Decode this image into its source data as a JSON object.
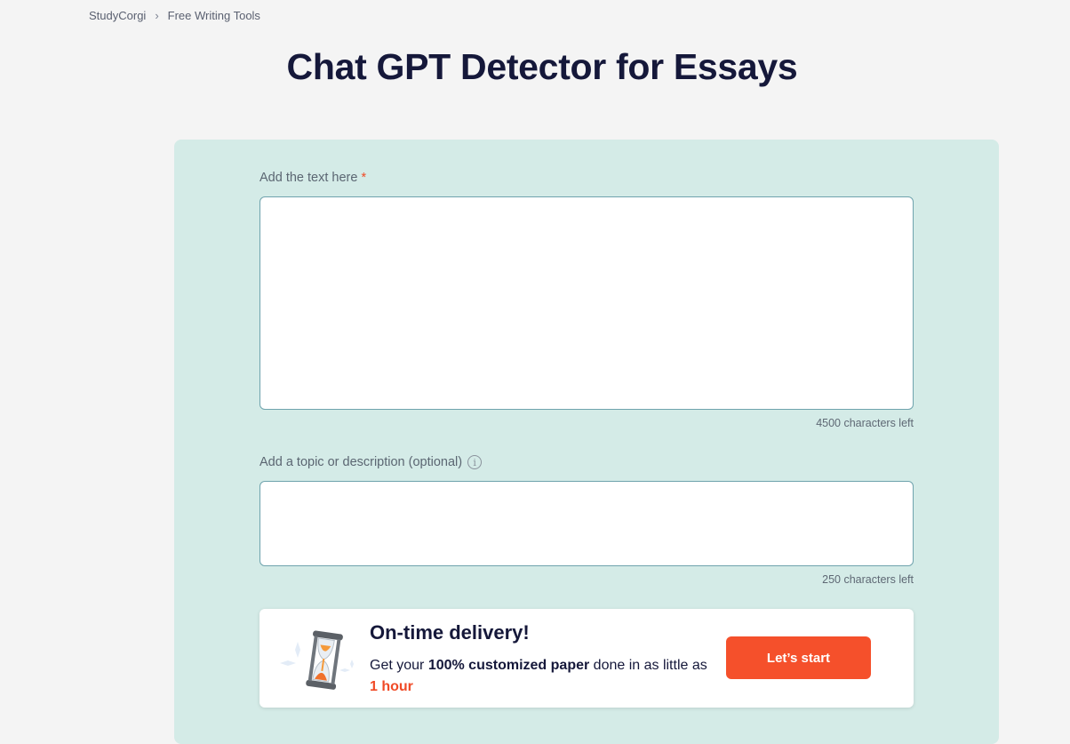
{
  "breadcrumb": {
    "items": [
      "StudyCorgi",
      "Free Writing Tools"
    ],
    "separator": "›"
  },
  "page": {
    "title": "Chat GPT Detector for Essays"
  },
  "form": {
    "text_field": {
      "label": "Add the text here",
      "required_mark": "*",
      "value": "",
      "counter": "4500 characters left"
    },
    "topic_field": {
      "label": "Add a topic or description (optional)",
      "info_icon": "i",
      "value": "",
      "counter": "250 characters left"
    }
  },
  "promo": {
    "icon": "hourglass-icon",
    "title": "On-time delivery!",
    "text_before": "Get your ",
    "text_bold": "100% customized paper",
    "text_middle": " done in as little as ",
    "text_accent": "1 hour",
    "button_label": "Let’s start"
  },
  "colors": {
    "accent": "#f5502b",
    "panel_bg": "#d4ebe7",
    "title": "#15183a",
    "page_bg": "#f4f4f4"
  }
}
